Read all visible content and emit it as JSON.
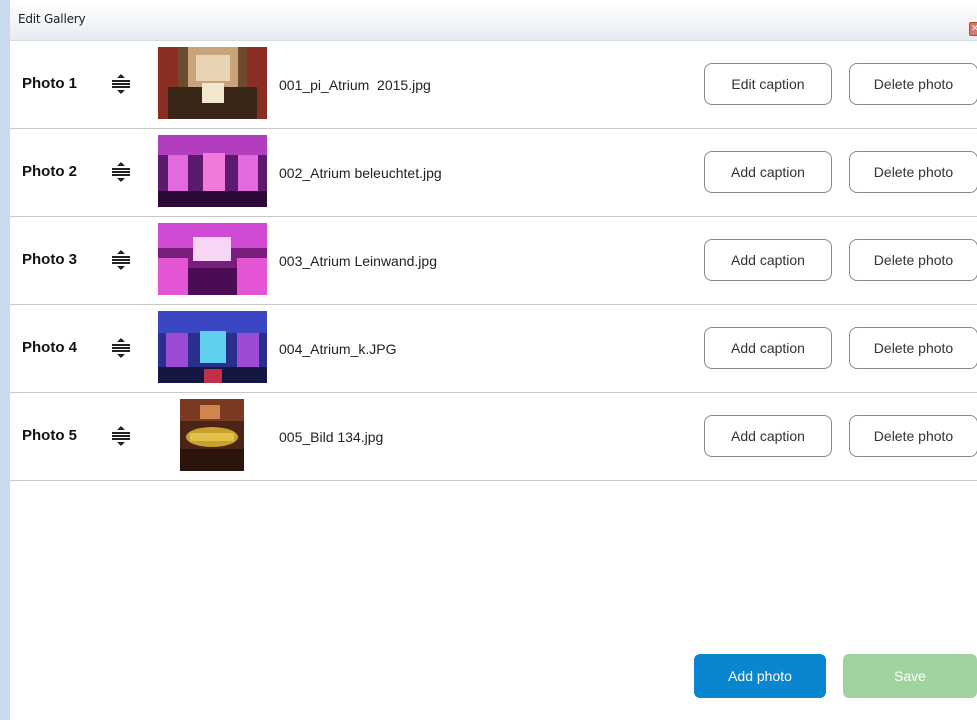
{
  "window": {
    "title": "Edit Gallery",
    "close_icon": "close-icon"
  },
  "photos": [
    {
      "label": "Photo 1",
      "filename": "001_pi_Atrium  2015.jpg",
      "caption_button": "Edit caption",
      "delete_button": "Delete photo"
    },
    {
      "label": "Photo 2",
      "filename": "002_Atrium beleuchtet.jpg",
      "caption_button": "Add caption",
      "delete_button": "Delete photo"
    },
    {
      "label": "Photo 3",
      "filename": "003_Atrium Leinwand.jpg",
      "caption_button": "Add caption",
      "delete_button": "Delete photo"
    },
    {
      "label": "Photo 4",
      "filename": "004_Atrium_k.JPG",
      "caption_button": "Add caption",
      "delete_button": "Delete photo"
    },
    {
      "label": "Photo 5",
      "filename": "005_Bild 134.jpg",
      "caption_button": "Add caption",
      "delete_button": "Delete photo"
    }
  ],
  "footer": {
    "add_photo": "Add photo",
    "save": "Save"
  },
  "colors": {
    "primary": "#0a86d0",
    "save_disabled": "#9fd49f"
  }
}
